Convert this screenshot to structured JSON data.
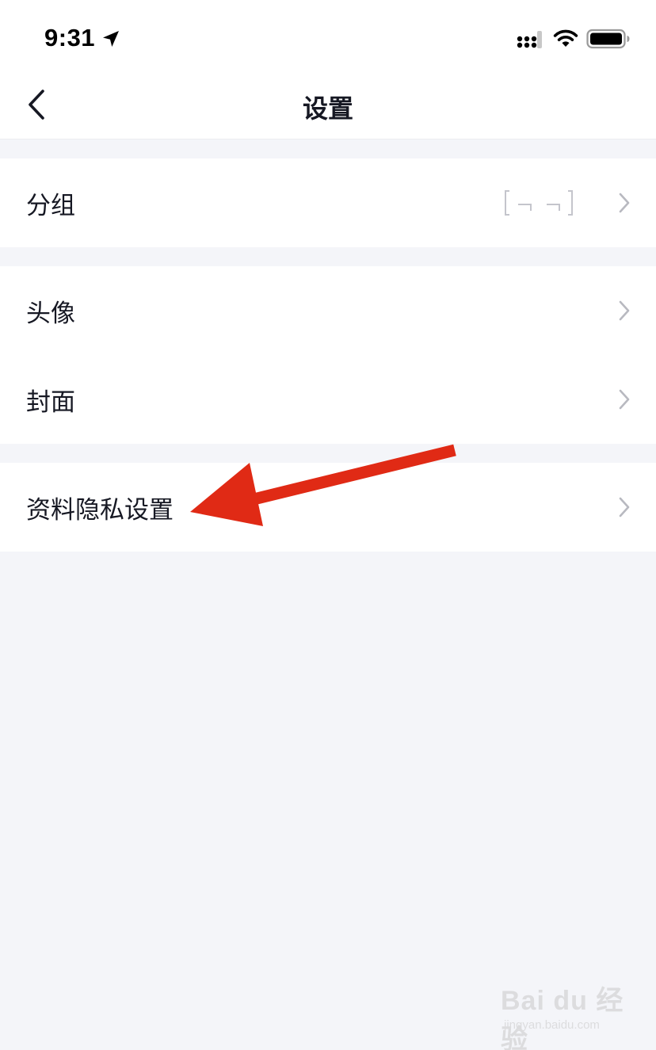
{
  "status_bar": {
    "time": "9:31",
    "icons": [
      "location-arrow-icon",
      "signal-icon",
      "wifi-icon",
      "battery-icon"
    ]
  },
  "nav": {
    "title": "设置",
    "back_icon": "chevron-left-icon"
  },
  "groups": [
    {
      "items": [
        {
          "label": "分组",
          "has_value_placeholder": true
        }
      ]
    },
    {
      "items": [
        {
          "label": "头像"
        },
        {
          "label": "封面"
        }
      ]
    },
    {
      "items": [
        {
          "label": "资料隐私设置"
        }
      ]
    }
  ],
  "annotation": {
    "color": "#e02a15",
    "icon": "red-arrow-icon"
  },
  "watermark": {
    "main": "Bai du 经验",
    "sub": "jingyan.baidu.com"
  },
  "colors": {
    "background": "#f4f5f9",
    "surface": "#ffffff",
    "text": "#161823",
    "chevron": "#b8b9c0"
  }
}
